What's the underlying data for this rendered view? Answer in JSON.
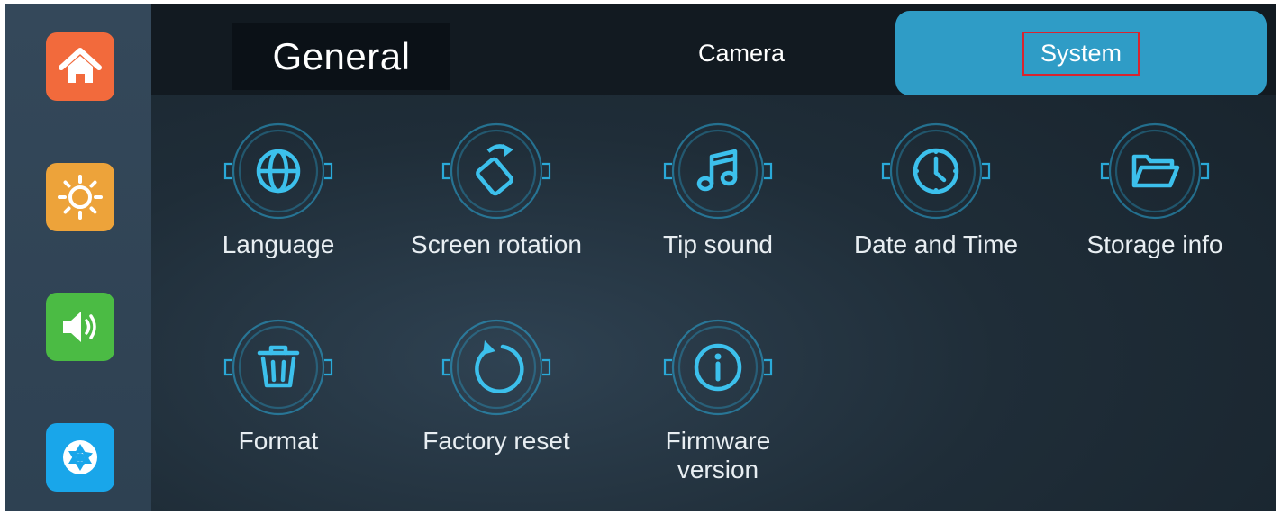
{
  "sidebar": {
    "items": [
      {
        "name": "home",
        "icon": "home-icon",
        "color": "#f26a3c"
      },
      {
        "name": "brightness",
        "icon": "sun-icon",
        "color": "#eda33a"
      },
      {
        "name": "sound",
        "icon": "speaker-icon",
        "color": "#4bbb44"
      },
      {
        "name": "camera",
        "icon": "aperture-icon",
        "color": "#19a6ea"
      }
    ]
  },
  "tabs": {
    "general": "General",
    "camera": "Camera",
    "system": "System",
    "active": "system",
    "active_color": "#2f9cc6",
    "highlight_color": "#d9242f"
  },
  "settings": [
    {
      "label": "Language",
      "icon": "globe-icon"
    },
    {
      "label": "Screen rotation",
      "icon": "screen-rotation-icon"
    },
    {
      "label": "Tip sound",
      "icon": "music-note-icon"
    },
    {
      "label": "Date and Time",
      "icon": "clock-icon"
    },
    {
      "label": "Storage info",
      "icon": "folder-icon"
    },
    {
      "label": "Format",
      "icon": "trash-icon"
    },
    {
      "label": "Factory reset",
      "icon": "reset-icon"
    },
    {
      "label": "Firmware\nversion",
      "icon": "info-icon"
    }
  ],
  "icon_color": "#2aa9d8"
}
